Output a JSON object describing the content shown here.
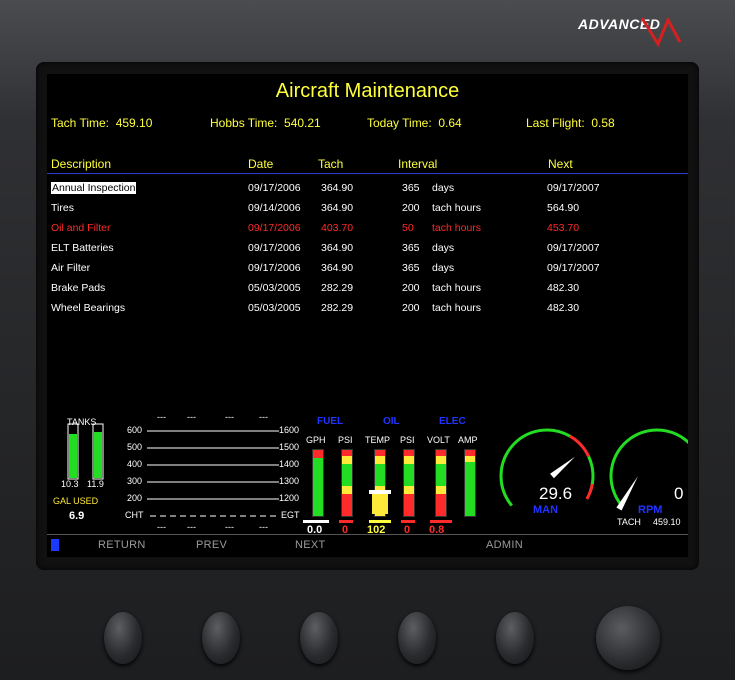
{
  "brand": "ADVANCED",
  "screen": {
    "title": "Aircraft Maintenance",
    "stats": {
      "tach_label": "Tach Time:",
      "tach_value": "459.10",
      "hobbs_label": "Hobbs Time:",
      "hobbs_value": "540.21",
      "today_label": "Today Time:",
      "today_value": "0.64",
      "last_label": "Last Flight:",
      "last_value": "0.58"
    },
    "columns": [
      "Description",
      "Date",
      "Tach",
      "Interval",
      "Next"
    ],
    "rows": [
      {
        "desc": "Annual Inspection",
        "date": "09/17/2006",
        "tach": "364.90",
        "interval": "365",
        "unit": "days",
        "next": "09/17/2007"
      },
      {
        "desc": "Tires",
        "date": "09/14/2006",
        "tach": "364.90",
        "interval": "200",
        "unit": "tach hours",
        "next": "564.90"
      },
      {
        "desc": "Oil and Filter",
        "date": "09/17/2006",
        "tach": "403.70",
        "interval": "50",
        "unit": "tach hours",
        "next": "453.70"
      },
      {
        "desc": "ELT Batteries",
        "date": "09/17/2006",
        "tach": "364.90",
        "interval": "365",
        "unit": "days",
        "next": "09/17/2007"
      },
      {
        "desc": "Air Filter",
        "date": "09/17/2006",
        "tach": "364.90",
        "interval": "365",
        "unit": "days",
        "next": "09/17/2007"
      },
      {
        "desc": "Brake Pads",
        "date": "05/03/2005",
        "tach": "282.29",
        "interval": "200",
        "unit": "tach hours",
        "next": "482.30"
      },
      {
        "desc": "Wheel Bearings",
        "date": "05/03/2005",
        "tach": "282.29",
        "interval": "200",
        "unit": "tach hours",
        "next": "482.30"
      }
    ],
    "engine": {
      "tanks_label": "TANKS",
      "tank_left": "10.3",
      "tank_right": "11.9",
      "gal_used_label": "GAL USED",
      "gal_used": "6.9",
      "cht_ticks": [
        "600",
        "500",
        "400",
        "300",
        "200"
      ],
      "egt_ticks": [
        "1600",
        "1500",
        "1400",
        "1300",
        "1200"
      ],
      "cht_label": "CHT",
      "egt_label": "EGT",
      "cyl_top": [
        "---",
        "---",
        "---",
        "---"
      ],
      "cyl_bottom": [
        "---",
        "---",
        "---",
        "---"
      ],
      "fuel_label": "FUEL",
      "oil_label": "OIL",
      "elec_label": "ELEC",
      "gph_label": "GPH",
      "gph_value": "0.0",
      "fuel_psi_label": "PSI",
      "fuel_psi_value": "0",
      "temp_label": "TEMP",
      "temp_value": "102",
      "oil_psi_label": "PSI",
      "oil_psi_value": "0",
      "volt_label": "VOLT",
      "volt_value": "0.8",
      "amp_label": "AMP",
      "man_value": "29.6",
      "man_label": "MAN",
      "rpm_value": "0",
      "rpm_label": "RPM",
      "tach_label": "TACH",
      "tach_value": "459.10"
    },
    "softkeys": [
      "RETURN",
      "PREV",
      "NEXT",
      "ADMIN"
    ]
  },
  "colors": {
    "yellow": "#ffff3c",
    "alert": "#ff2a2a",
    "blue": "#2233ff",
    "green": "#22dd22"
  }
}
